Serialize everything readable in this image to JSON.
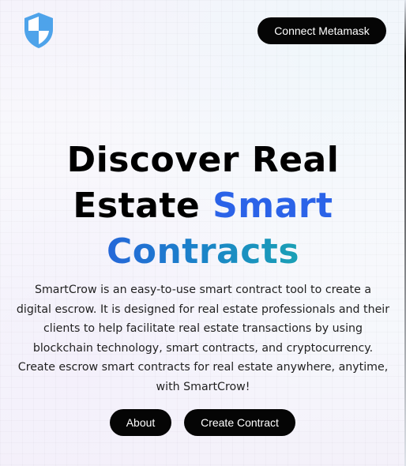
{
  "header": {
    "logo_icon": "shield-icon",
    "connect_label": "Connect Metamask"
  },
  "hero": {
    "title_line1": "Discover Real",
    "title_line2_plain": "Estate ",
    "title_line2_highlight": "Smart",
    "title_line3_highlight": "Contracts",
    "description": "SmartCrow is an easy-to-use smart contract tool to create a digital escrow. It is designed for real estate professionals and their clients to help facilitate real estate transactions by using blockchain technology, smart contracts, and cryptocurrency. Create escrow smart contracts for real estate anywhere, anytime, with SmartCrow!"
  },
  "actions": {
    "about_label": "About",
    "create_label": "Create Contract"
  },
  "colors": {
    "accent_blue": "#2b63e8",
    "accent_teal": "#1aa0b5",
    "button_bg": "#050505",
    "shield_blue": "#4ea3ea"
  }
}
